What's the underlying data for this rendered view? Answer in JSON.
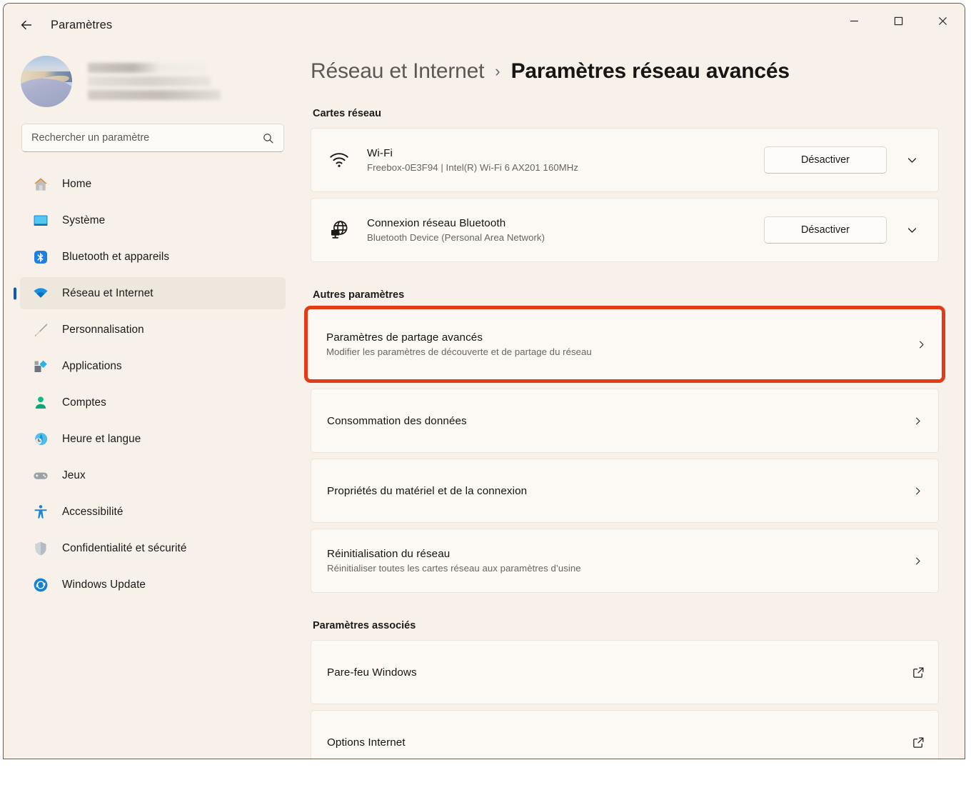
{
  "window": {
    "app_title": "Paramètres",
    "back_icon": "arrow-left-icon",
    "controls": {
      "minimize": "minimize-icon",
      "maximize": "maximize-icon",
      "close": "close-icon"
    }
  },
  "sidebar": {
    "account": {
      "avatar": "user-avatar-photo",
      "name_redacted": true
    },
    "search": {
      "placeholder": "Rechercher un paramètre",
      "value": "",
      "icon": "search-icon"
    },
    "items": [
      {
        "label": "Home",
        "icon": "home-icon",
        "active": false
      },
      {
        "label": "Système",
        "icon": "display-icon",
        "active": false
      },
      {
        "label": "Bluetooth et appareils",
        "icon": "bluetooth-icon",
        "active": false
      },
      {
        "label": "Réseau et Internet",
        "icon": "wifi-icon",
        "active": true
      },
      {
        "label": "Personnalisation",
        "icon": "brush-icon",
        "active": false
      },
      {
        "label": "Applications",
        "icon": "apps-icon",
        "active": false
      },
      {
        "label": "Comptes",
        "icon": "person-icon",
        "active": false
      },
      {
        "label": "Heure et langue",
        "icon": "clock-globe-icon",
        "active": false
      },
      {
        "label": "Jeux",
        "icon": "gamepad-icon",
        "active": false
      },
      {
        "label": "Accessibilité",
        "icon": "accessibility-icon",
        "active": false
      },
      {
        "label": "Confidentialité et sécurité",
        "icon": "shield-icon",
        "active": false
      },
      {
        "label": "Windows Update",
        "icon": "update-icon",
        "active": false
      }
    ]
  },
  "main": {
    "breadcrumb": {
      "parent": "Réseau et Internet",
      "separator": "›",
      "current": "Paramètres réseau avancés"
    },
    "sections": {
      "adapters_heading": "Cartes réseau",
      "other_heading": "Autres paramètres",
      "related_heading": "Paramètres associés"
    },
    "adapters": [
      {
        "icon": "wifi-icon",
        "title": "Wi-Fi",
        "subtitle": "Freebox-0E3F94 | Intel(R) Wi-Fi 6 AX201 160MHz",
        "button_label": "Désactiver",
        "expand_icon": "chevron-down-icon"
      },
      {
        "icon": "network-globe-icon",
        "title": "Connexion réseau Bluetooth",
        "subtitle": "Bluetooth Device (Personal Area Network)",
        "button_label": "Désactiver",
        "expand_icon": "chevron-down-icon"
      }
    ],
    "other_settings": [
      {
        "title": "Paramètres de partage avancés",
        "subtitle": "Modifier les paramètres de découverte et de partage du réseau",
        "chevron": "chevron-right-icon",
        "highlighted": true
      },
      {
        "title": "Consommation des données",
        "subtitle": "",
        "chevron": "chevron-right-icon",
        "highlighted": false
      },
      {
        "title": "Propriétés du matériel et de la connexion",
        "subtitle": "",
        "chevron": "chevron-right-icon",
        "highlighted": false
      },
      {
        "title": "Réinitialisation du réseau",
        "subtitle": "Réinitialiser toutes les cartes réseau aux paramètres d’usine",
        "chevron": "chevron-right-icon",
        "highlighted": false
      }
    ],
    "related_settings": [
      {
        "title": "Pare-feu Windows",
        "icon": "external-link-icon"
      },
      {
        "title": "Options Internet",
        "icon": "external-link-icon"
      }
    ]
  },
  "colors": {
    "window_background": "#f8f1e9",
    "card_background": "#fcf9f5",
    "highlight_red": "#e13b18",
    "accent_blue": "#0d5bb9",
    "text_primary": "#16140f",
    "text_secondary": "#6a645c"
  }
}
